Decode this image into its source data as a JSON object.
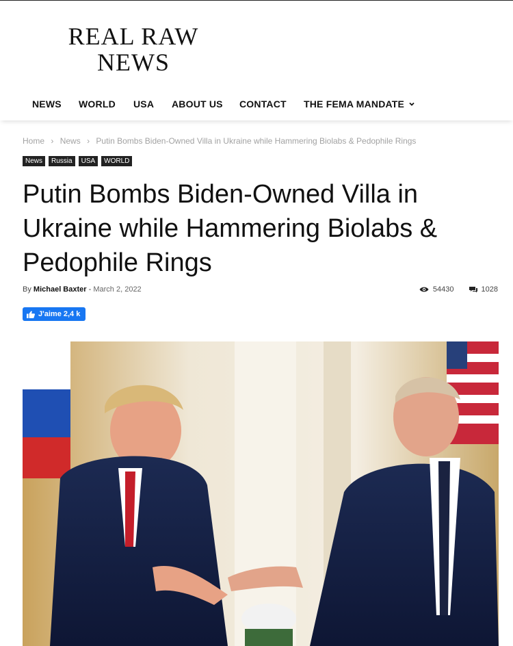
{
  "site": {
    "logo_line1": "REAL RAW",
    "logo_line2": "NEWS"
  },
  "nav": {
    "items": [
      "NEWS",
      "WORLD",
      "USA",
      "ABOUT US",
      "CONTACT",
      "THE FEMA MANDATE"
    ]
  },
  "breadcrumb": {
    "home": "Home",
    "section": "News",
    "current": "Putin Bombs Biden-Owned Villa in Ukraine while Hammering Biolabs & Pedophile Rings"
  },
  "tags": [
    "News",
    "Russia",
    "USA",
    "WORLD"
  ],
  "article": {
    "title": "Putin Bombs Biden-Owned Villa in Ukraine while Hammering Biolabs & Pedophile Rings",
    "by_label": "By",
    "author": "Michael Baxter",
    "separator": "-",
    "date": "March 2, 2022",
    "views": "54430",
    "comments": "1028"
  },
  "facebook": {
    "like_label": "J'aime 2,4 k"
  },
  "colors": {
    "facebook_blue": "#1877f2",
    "tag_bg": "#222222"
  }
}
